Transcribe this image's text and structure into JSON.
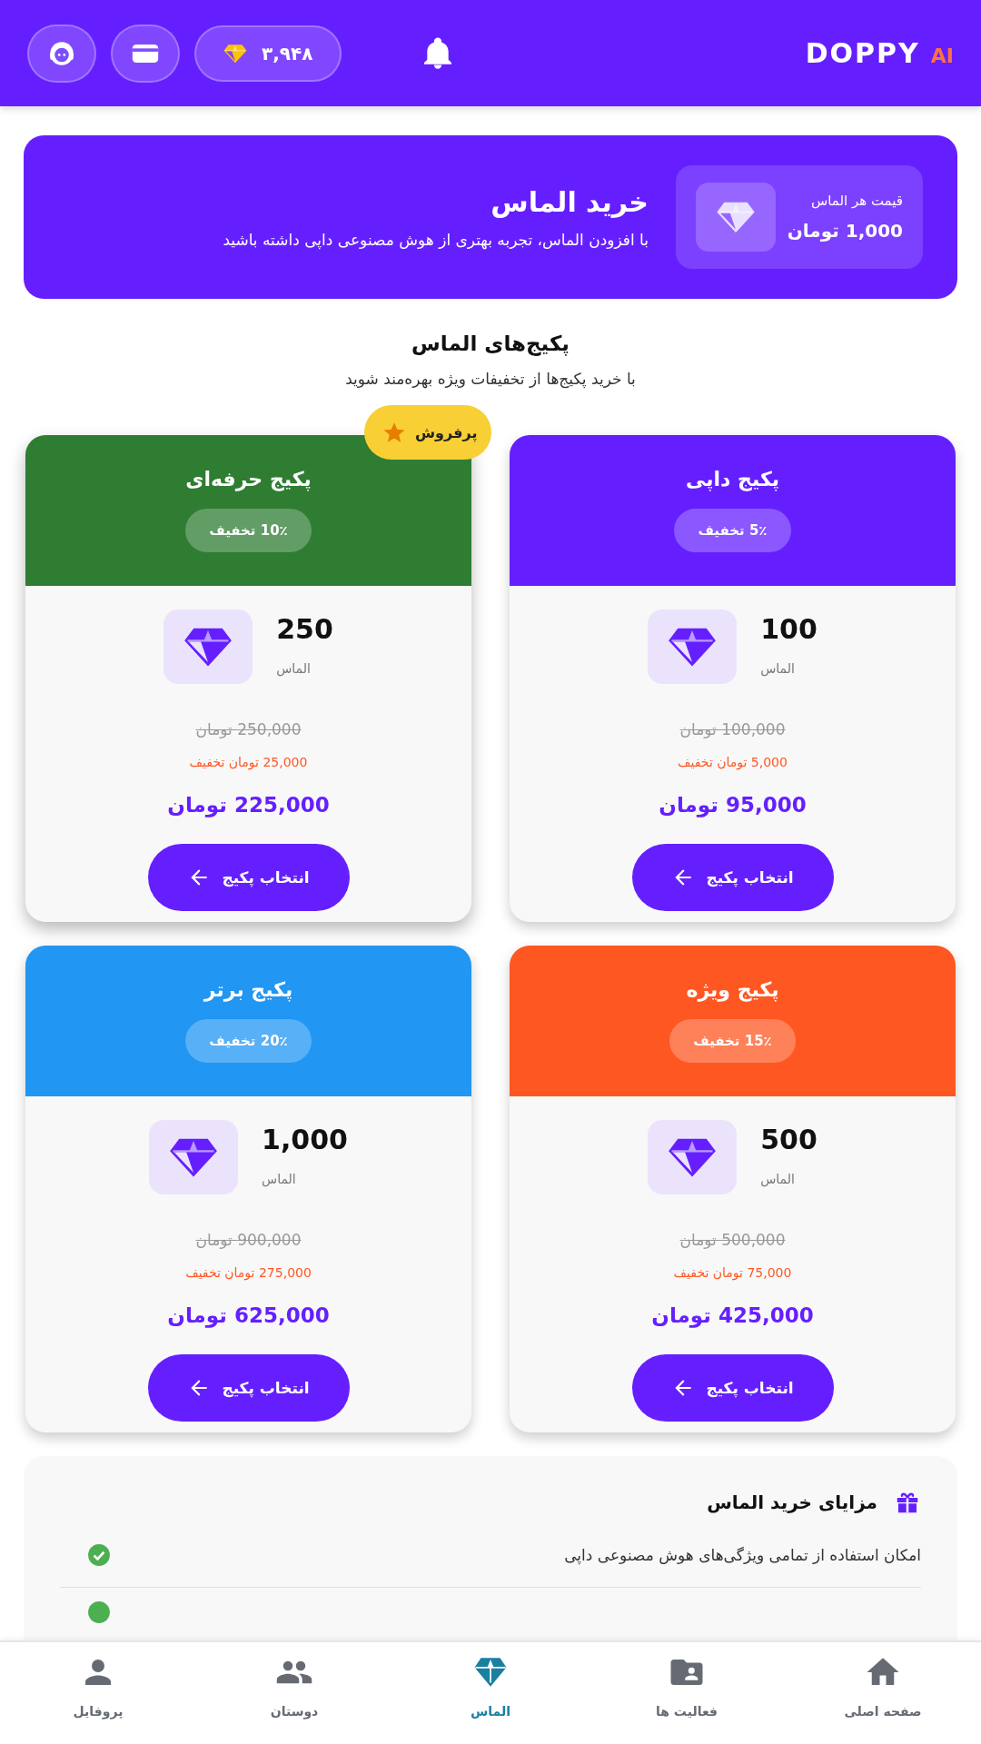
{
  "header": {
    "logo": "DOPPY",
    "logo_suffix": "AI",
    "diamond_balance": "۳,۹۴۸"
  },
  "banner": {
    "title": "خرید الماس",
    "subtitle": "با افزودن الماس، تجربه بهتری از هوش مصنوعی داپی داشته باشید",
    "price_label": "قیمت هر الماس",
    "price": "1,000 تومان"
  },
  "bestseller_badge": "پرفروش",
  "section": {
    "title": "پکیج‌های الماس",
    "subtitle": "با خرید پکیج‌ها از تخفیفات ویژه بهره‌مند شوید"
  },
  "packages": [
    {
      "name": "پکیج داپی",
      "discount": "5٪ تخفیف",
      "color": "#651fff",
      "amount": "100",
      "unit": "الماس",
      "old_price": "100,000 تومان",
      "saving": "5,000 تومان تخفیف",
      "price": "95,000 تومان",
      "button": "انتخاب پکیج",
      "featured": false
    },
    {
      "name": "پکیج حرفه‌ای",
      "discount": "10٪ تخفیف",
      "color": "#2e7d32",
      "amount": "250",
      "unit": "الماس",
      "old_price": "250,000 تومان",
      "saving": "25,000 تومان تخفیف",
      "price": "225,000 تومان",
      "button": "انتخاب پکیج",
      "featured": true
    },
    {
      "name": "پکیج ویژه",
      "discount": "15٪ تخفیف",
      "color": "#ff5722",
      "amount": "500",
      "unit": "الماس",
      "old_price": "500,000 تومان",
      "saving": "75,000 تومان تخفیف",
      "price": "425,000 تومان",
      "button": "انتخاب پکیج",
      "featured": false
    },
    {
      "name": "پکیج برتر",
      "discount": "20٪ تخفیف",
      "color": "#2196f3",
      "amount": "1,000",
      "unit": "الماس",
      "old_price": "900,000 تومان",
      "saving": "275,000 تومان تخفیف",
      "price": "625,000 تومان",
      "button": "انتخاب پکیج",
      "featured": false
    }
  ],
  "benefits": {
    "title": "مزایای خرید الماس",
    "items": [
      "امکان استفاده از تمامی ویژگی‌های هوش مصنوعی داپی"
    ]
  },
  "bottom_nav": [
    {
      "label": "صفحه اصلی",
      "kind": "home",
      "selected": false
    },
    {
      "label": "فعالیت ها",
      "kind": "activities",
      "selected": false
    },
    {
      "label": "الماس",
      "kind": "diamond",
      "selected": true
    },
    {
      "label": "دوستان",
      "kind": "friends",
      "selected": false
    },
    {
      "label": "پروفایل",
      "kind": "profile",
      "selected": false
    }
  ]
}
